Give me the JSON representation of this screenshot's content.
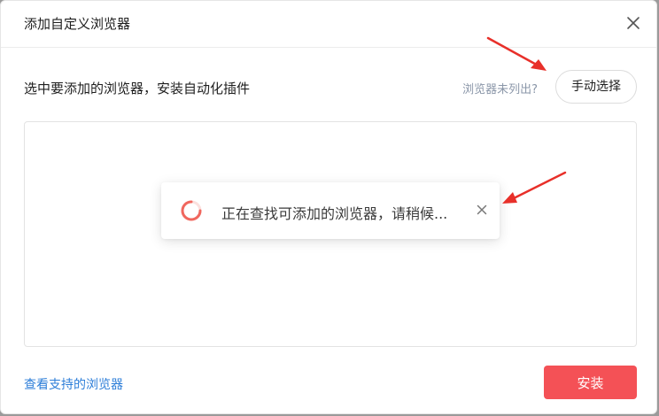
{
  "dialog": {
    "title": "添加自定义浏览器",
    "close_icon": "close-icon"
  },
  "instruction": {
    "text": "选中要添加的浏览器，安装自动化插件",
    "not_listed": "浏览器未列出?",
    "manual_select_label": "手动选择"
  },
  "toast": {
    "message": "正在查找可添加的浏览器，请稍候...",
    "spinner_icon": "loading-spinner-icon",
    "close_icon": "close-icon"
  },
  "footer": {
    "supported_link": "查看支持的浏览器",
    "install_label": "安装"
  },
  "colors": {
    "accent_red": "#f45156",
    "link_blue": "#2d7ed8",
    "muted_text": "#8a96a8",
    "annotation_arrow": "#e8302a"
  }
}
